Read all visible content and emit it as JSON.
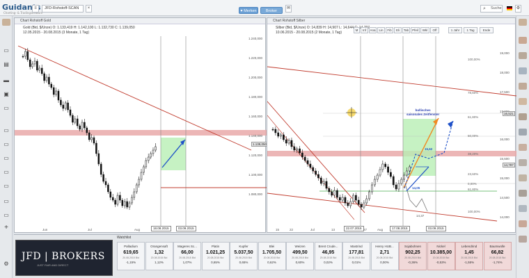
{
  "app": {
    "logo": "Guidants",
    "logo_sub": "Charting- & Tradingsoftware",
    "workspace_tab": "JFD-Rohstoff-SCAN",
    "buttons": {
      "new": "+ Neu",
      "tab_add": "+",
      "bell": "✉",
      "heart": "♥ Merken",
      "login": "Broker Login",
      "search": "Suche"
    }
  },
  "chart_left": {
    "title": "Chart Rohstoff Gold",
    "info1": "Gold (Bid, $/Unze)  O: 1.133,419  H: 1.142,100  L: 1.132,730  C: 1.139,050",
    "info2": "12.05.2015 - 20.08.2015 (3 Monate, 1 Tag)",
    "y_ticks": [
      "1.240,000",
      "1.220,000",
      "1.200,000",
      "1.180,000",
      "1.160,000",
      "1.140,000",
      "1.120,000",
      "1.100,000",
      "1.080,000"
    ],
    "y_tag": "1.139,050",
    "x_ticks": [
      "Jun",
      "Jul",
      "Aug"
    ],
    "x_dates": [
      "18.08.2015",
      "03.09.2015"
    ]
  },
  "chart_right": {
    "title": "Chart Rohstoff Silber",
    "info1": "Silber (Bid, $/Unze)  O: 14,839  H: 14,907  L: 14,644  C: 14,797",
    "info2": "10.06.2015 - 20.08.2015 (2 Monate, 1 Tag)",
    "toolbar": [
      "M",
      "Inf",
      "Ana",
      "Lin",
      "Fib",
      "Eli",
      "Tab",
      "Pfeil",
      "Wkl",
      "Off",
      "1 Jahr",
      "1 Tag",
      "Ende"
    ],
    "y_ticks": [
      "19,000",
      "18,000",
      "17,500",
      "17,000",
      "16,000",
      "15,500",
      "15,000",
      "14,500",
      "14,000"
    ],
    "y_tag": "14,797",
    "y_tag2": "16,521",
    "fib_labels": [
      "100,00%",
      "78,60%",
      "61,80%",
      "50,00%",
      "38,20%",
      "23,60%",
      "0,00%",
      "61,80%",
      "100,00%"
    ],
    "x_ticks": [
      "15",
      "22",
      "Jul",
      "13",
      "20",
      "27",
      "Aug",
      "10"
    ],
    "x_dates": [
      "22.07.2015",
      "17.08.2015",
      "03.09.2015"
    ],
    "annotation": "bullisches\nsaisonales Zeitfenster",
    "label_low": "14,05",
    "label_mid": "15,62",
    "label_bottom": "14,37"
  },
  "watchlist": {
    "title": "Watchlist",
    "broker_name": "JFD | BROKERS",
    "broker_tagline": "JUST FAIR AND DIRECT",
    "tiles": [
      {
        "name": "Palladium",
        "value": "619,65",
        "date": "20.08.2015 Bid",
        "change": "-1,15%",
        "red": false
      },
      {
        "name": "Orangensaft",
        "value": "1,32",
        "date": "20.08.2015 Bid",
        "change": "1,12%",
        "red": false
      },
      {
        "name": "Mageres Sc...",
        "value": "66,00",
        "date": "20.08.2015 Bid",
        "change": "1,07%",
        "red": false
      },
      {
        "name": "Platin",
        "value": "1.021,25",
        "date": "20.08.2015 Bid",
        "change": "0,65%",
        "red": false
      },
      {
        "name": "Kupfer",
        "value": "5.037,50",
        "date": "20.08.2015 Bid",
        "change": "0,65%",
        "red": false
      },
      {
        "name": "Blei",
        "value": "1.705,50",
        "date": "20.08.2015 Bid",
        "change": "0,62%",
        "red": false
      },
      {
        "name": "Weizen",
        "value": "499,50",
        "date": "20.08.2015 Bid",
        "change": "0,60%",
        "red": false
      },
      {
        "name": "Brent Crude...",
        "value": "46,95",
        "date": "20.08.2015 Bid",
        "change": "0,02%",
        "red": false
      },
      {
        "name": "Mastrind",
        "value": "177,81",
        "date": "20.08.2015 Bid",
        "change": "0,01%",
        "red": false
      },
      {
        "name": "Henry HUB...",
        "value": "2,71",
        "date": "20.08.2015 Bid",
        "change": "0,00%",
        "red": false
      },
      {
        "name": "Sojabohnen",
        "value": "902,25",
        "date": "20.08.2015 Bid",
        "change": "-0,36%",
        "red": true
      },
      {
        "name": "Nickel",
        "value": "10.385,00",
        "date": "20.08.2015 Bid",
        "change": "-0,53%",
        "red": true
      },
      {
        "name": "Lebendrind",
        "value": "1,45",
        "date": "20.08.2015 Bid",
        "change": "-1,55%",
        "red": true
      },
      {
        "name": "Baumwolle",
        "value": "66,82",
        "date": "20.08.2015 Bid",
        "change": "-1,74%",
        "red": true
      }
    ]
  }
}
